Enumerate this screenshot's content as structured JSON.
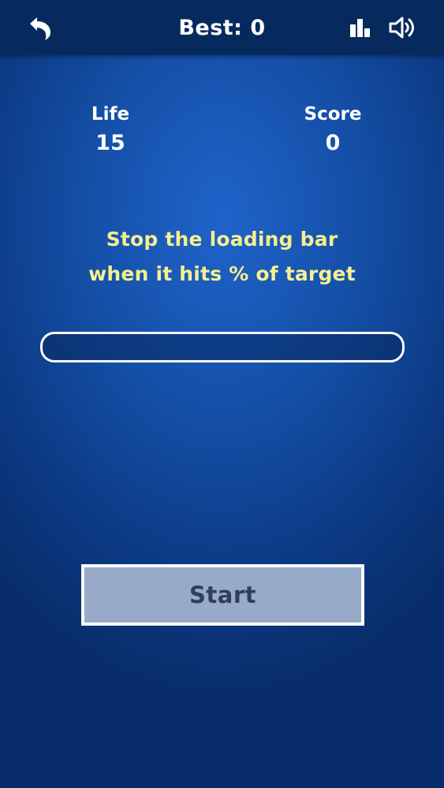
{
  "header": {
    "back_icon": "back-arrow-icon",
    "best_label": "Best: 0",
    "stats_icon": "bar-chart-icon",
    "sound_icon": "speaker-icon"
  },
  "stats": {
    "life_label": "Life",
    "life_value": "15",
    "score_label": "Score",
    "score_value": "0"
  },
  "instruction": {
    "line1": "Stop the loading bar",
    "line2": "when it hits % of target"
  },
  "loading_bar": {
    "progress_percent": 0
  },
  "start_button": {
    "label": "Start"
  },
  "colors": {
    "background": "#1550a8",
    "topbar": "#072a5e",
    "instruction_text": "#f6f08f",
    "button_fill": "#97aac8",
    "button_text": "#2f3f55"
  }
}
